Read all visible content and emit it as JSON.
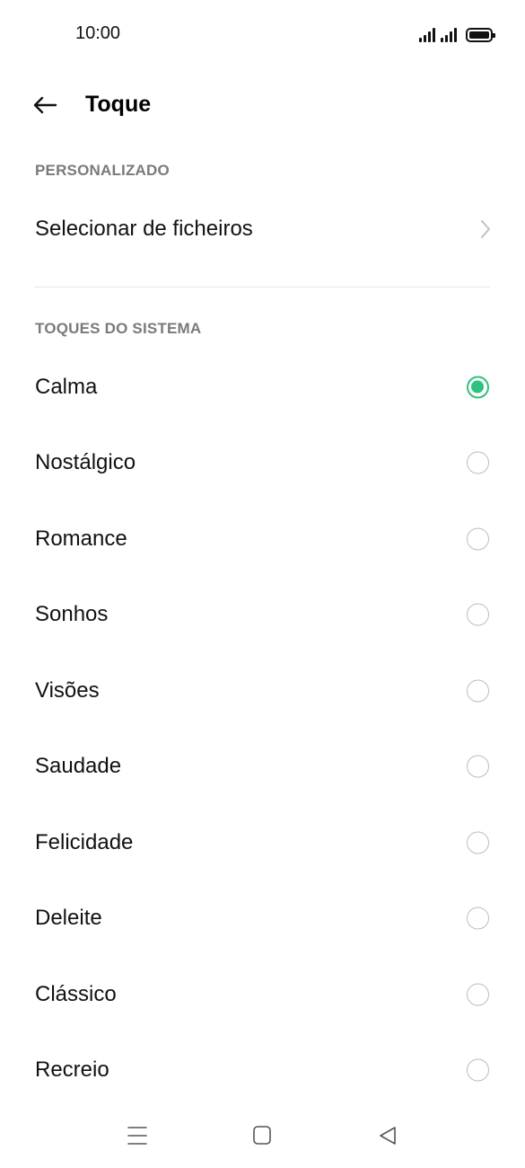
{
  "status_bar": {
    "time": "10:00",
    "icons": [
      "signal-icon",
      "signal-icon",
      "battery-icon"
    ]
  },
  "header": {
    "back_icon": "arrow-left-icon",
    "title": "Toque"
  },
  "custom_section": {
    "label": "PERSONALIZADO",
    "items": [
      {
        "label": "Selecionar de ficheiros",
        "icon": "chevron-right-icon"
      }
    ]
  },
  "system_section": {
    "label": "TOQUES DO SISTEMA",
    "items": [
      {
        "label": "Calma",
        "selected": true
      },
      {
        "label": "Nostálgico",
        "selected": false
      },
      {
        "label": "Romance",
        "selected": false
      },
      {
        "label": "Sonhos",
        "selected": false
      },
      {
        "label": "Visões",
        "selected": false
      },
      {
        "label": "Saudade",
        "selected": false
      },
      {
        "label": "Felicidade",
        "selected": false
      },
      {
        "label": "Deleite",
        "selected": false
      },
      {
        "label": "Clássico",
        "selected": false
      },
      {
        "label": "Recreio",
        "selected": false
      }
    ]
  },
  "nav_bar": {
    "icons": [
      "menu-icon",
      "home-icon",
      "back-triangle-icon"
    ]
  },
  "colors": {
    "accent": "#2ec27e",
    "section_label": "#7a7a7a",
    "divider": "#e6e6e6"
  }
}
